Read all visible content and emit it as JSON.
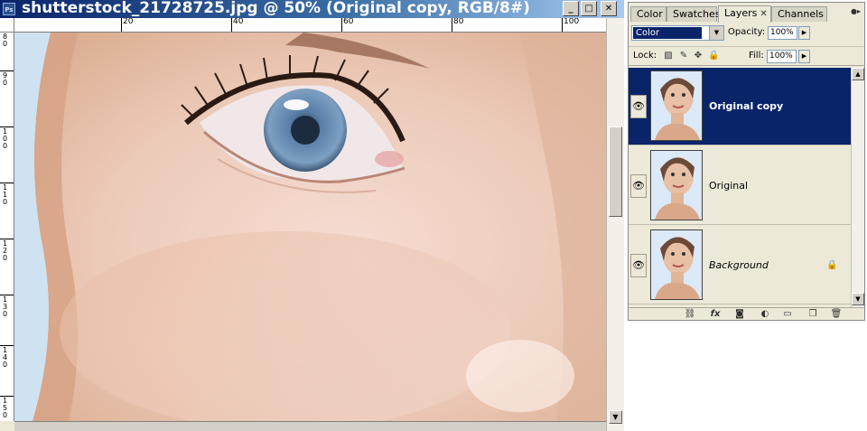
{
  "document": {
    "title": "shutterstock_21728725.jpg @ 50% (Original copy, RGB/8#)",
    "app_icon_label": "Ps",
    "hruler_ticks": [
      "20",
      "40",
      "60",
      "80",
      "100"
    ],
    "vruler_ticks": [
      "8 0",
      "9 0",
      "1 0 0",
      "1 1 0",
      "1 2 0",
      "1 3 0",
      "1 4 0",
      "1 5 0"
    ]
  },
  "palette": {
    "tabs": [
      {
        "label": "Color",
        "active": false
      },
      {
        "label": "Swatches",
        "active": false
      },
      {
        "label": "Layers",
        "active": true
      },
      {
        "label": "Channels",
        "active": false
      }
    ],
    "blend_mode": "Color",
    "opacity_label": "Opacity:",
    "opacity_value": "100%",
    "lock_label": "Lock:",
    "fill_label": "Fill:",
    "fill_value": "100%",
    "layers": [
      {
        "name": "Original copy",
        "selected": true,
        "locked": false
      },
      {
        "name": "Original",
        "selected": false,
        "locked": false
      },
      {
        "name": "Background",
        "selected": false,
        "locked": true
      }
    ],
    "bottom_icons": [
      "link-icon",
      "fx-icon",
      "mask-icon",
      "adjustment-icon",
      "folder-icon",
      "new-layer-icon",
      "trash-icon"
    ]
  },
  "colors": {
    "title_bar": "#0a246a",
    "selection": "#0a246a",
    "skin": "#e9c7b2",
    "iris": "#5a7fa8"
  }
}
